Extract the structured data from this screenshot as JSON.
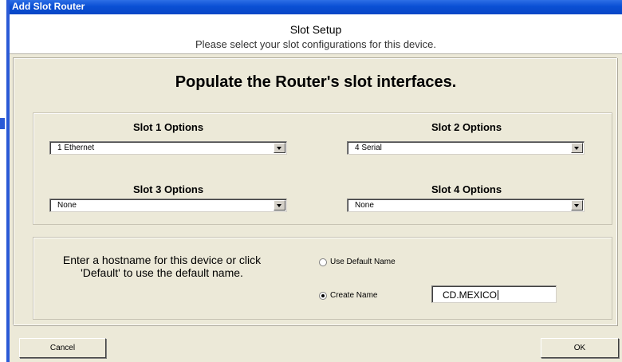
{
  "window": {
    "title": "Add Slot Router"
  },
  "header": {
    "title": "Slot Setup",
    "subtitle": "Please select your slot configurations for this device."
  },
  "main": {
    "heading": "Populate the Router's slot interfaces.",
    "slots": [
      {
        "label": "Slot 1 Options",
        "value": "1 Ethernet"
      },
      {
        "label": "Slot 2 Options",
        "value": "4 Serial"
      },
      {
        "label": "Slot 3 Options",
        "value": "None"
      },
      {
        "label": "Slot 4 Options",
        "value": "None"
      }
    ]
  },
  "hostname": {
    "instructions": "Enter a hostname for this device or click 'Default' to use the default name.",
    "use_default_label": "Use Default Name",
    "use_default_selected": false,
    "create_name_label": "Create Name",
    "create_name_selected": true,
    "value": "CD.MEXICO"
  },
  "buttons": {
    "cancel": "Cancel",
    "ok": "OK"
  },
  "colors": {
    "title_bar": "#0a4fd4",
    "dialog_bg": "#ece9d8"
  },
  "icons": {
    "dropdown": "chevron-down-icon",
    "radio": "radio-icon"
  }
}
